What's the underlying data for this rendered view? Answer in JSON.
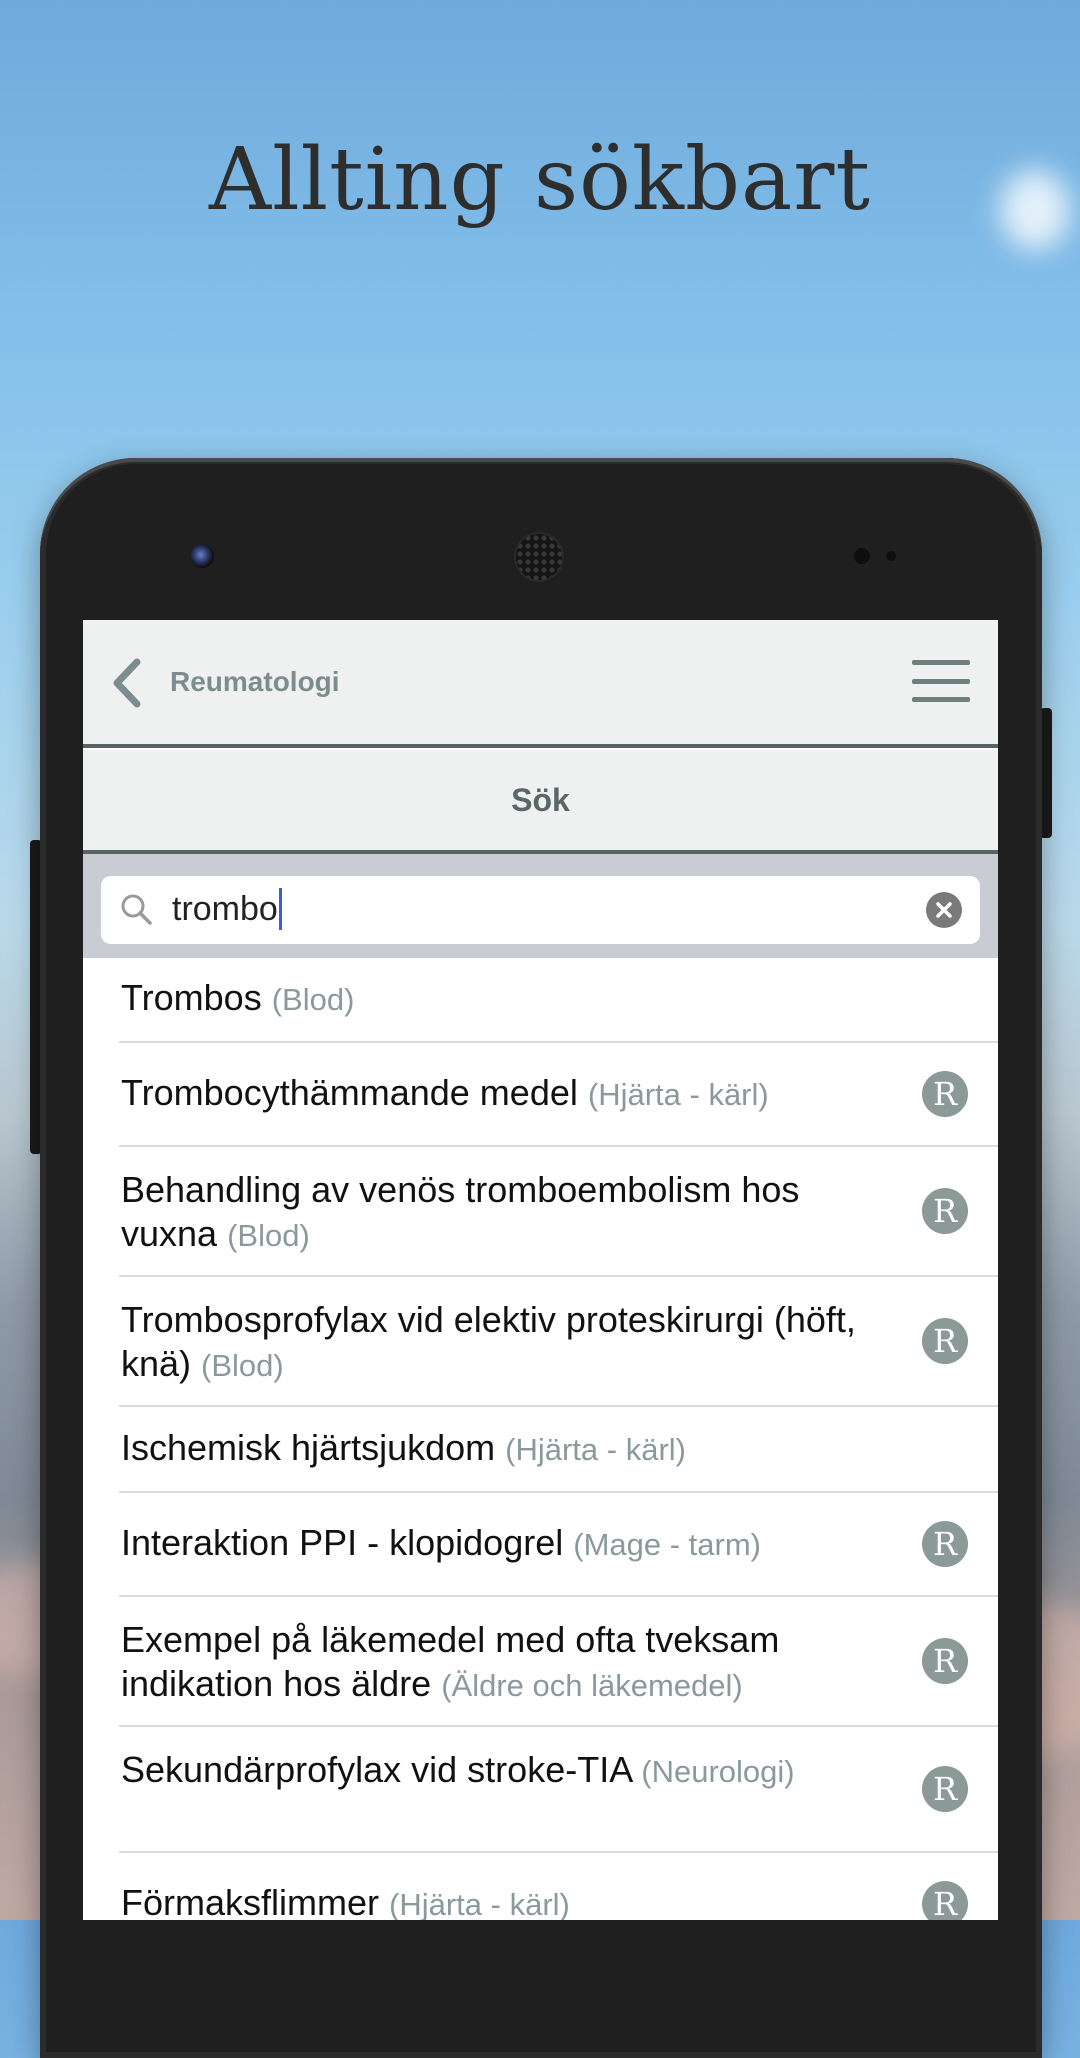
{
  "headline": "Allting sökbart",
  "app": {
    "back_label": "Reumatologi",
    "title": "Sök"
  },
  "search": {
    "value": "trombo"
  },
  "results": [
    {
      "title": "Trombos",
      "category": "(Blod)",
      "badge": ""
    },
    {
      "title": "Trombocythämmande medel",
      "category": "(Hjärta - kärl)",
      "badge": "R"
    },
    {
      "title": "Behandling av venös tromboembolism hos vuxna",
      "category": "(Blod)",
      "badge": "R"
    },
    {
      "title": "Trombosprofylax vid elektiv proteskirurgi (höft, knä)",
      "category": "(Blod)",
      "badge": "R"
    },
    {
      "title": "Ischemisk hjärtsjukdom",
      "category": "(Hjärta - kärl)",
      "badge": ""
    },
    {
      "title": "Interaktion PPI - klopidogrel",
      "category": "(Mage - tarm)",
      "badge": "R"
    },
    {
      "title": "Exempel på läkemedel med ofta tveksam indikation hos äldre",
      "category": "(Äldre och läkemedel)",
      "badge": "R"
    },
    {
      "title": "Sekundärprofylax vid stroke-TIA",
      "category": "(Neurologi)",
      "badge": "R"
    },
    {
      "title": "Förmaksflimmer",
      "category": "(Hjärta - kärl)",
      "badge": "R"
    }
  ],
  "colors": {
    "accent_bar": "#566465",
    "badge": "#8b9a97",
    "category_text": "#8a9a9c"
  }
}
